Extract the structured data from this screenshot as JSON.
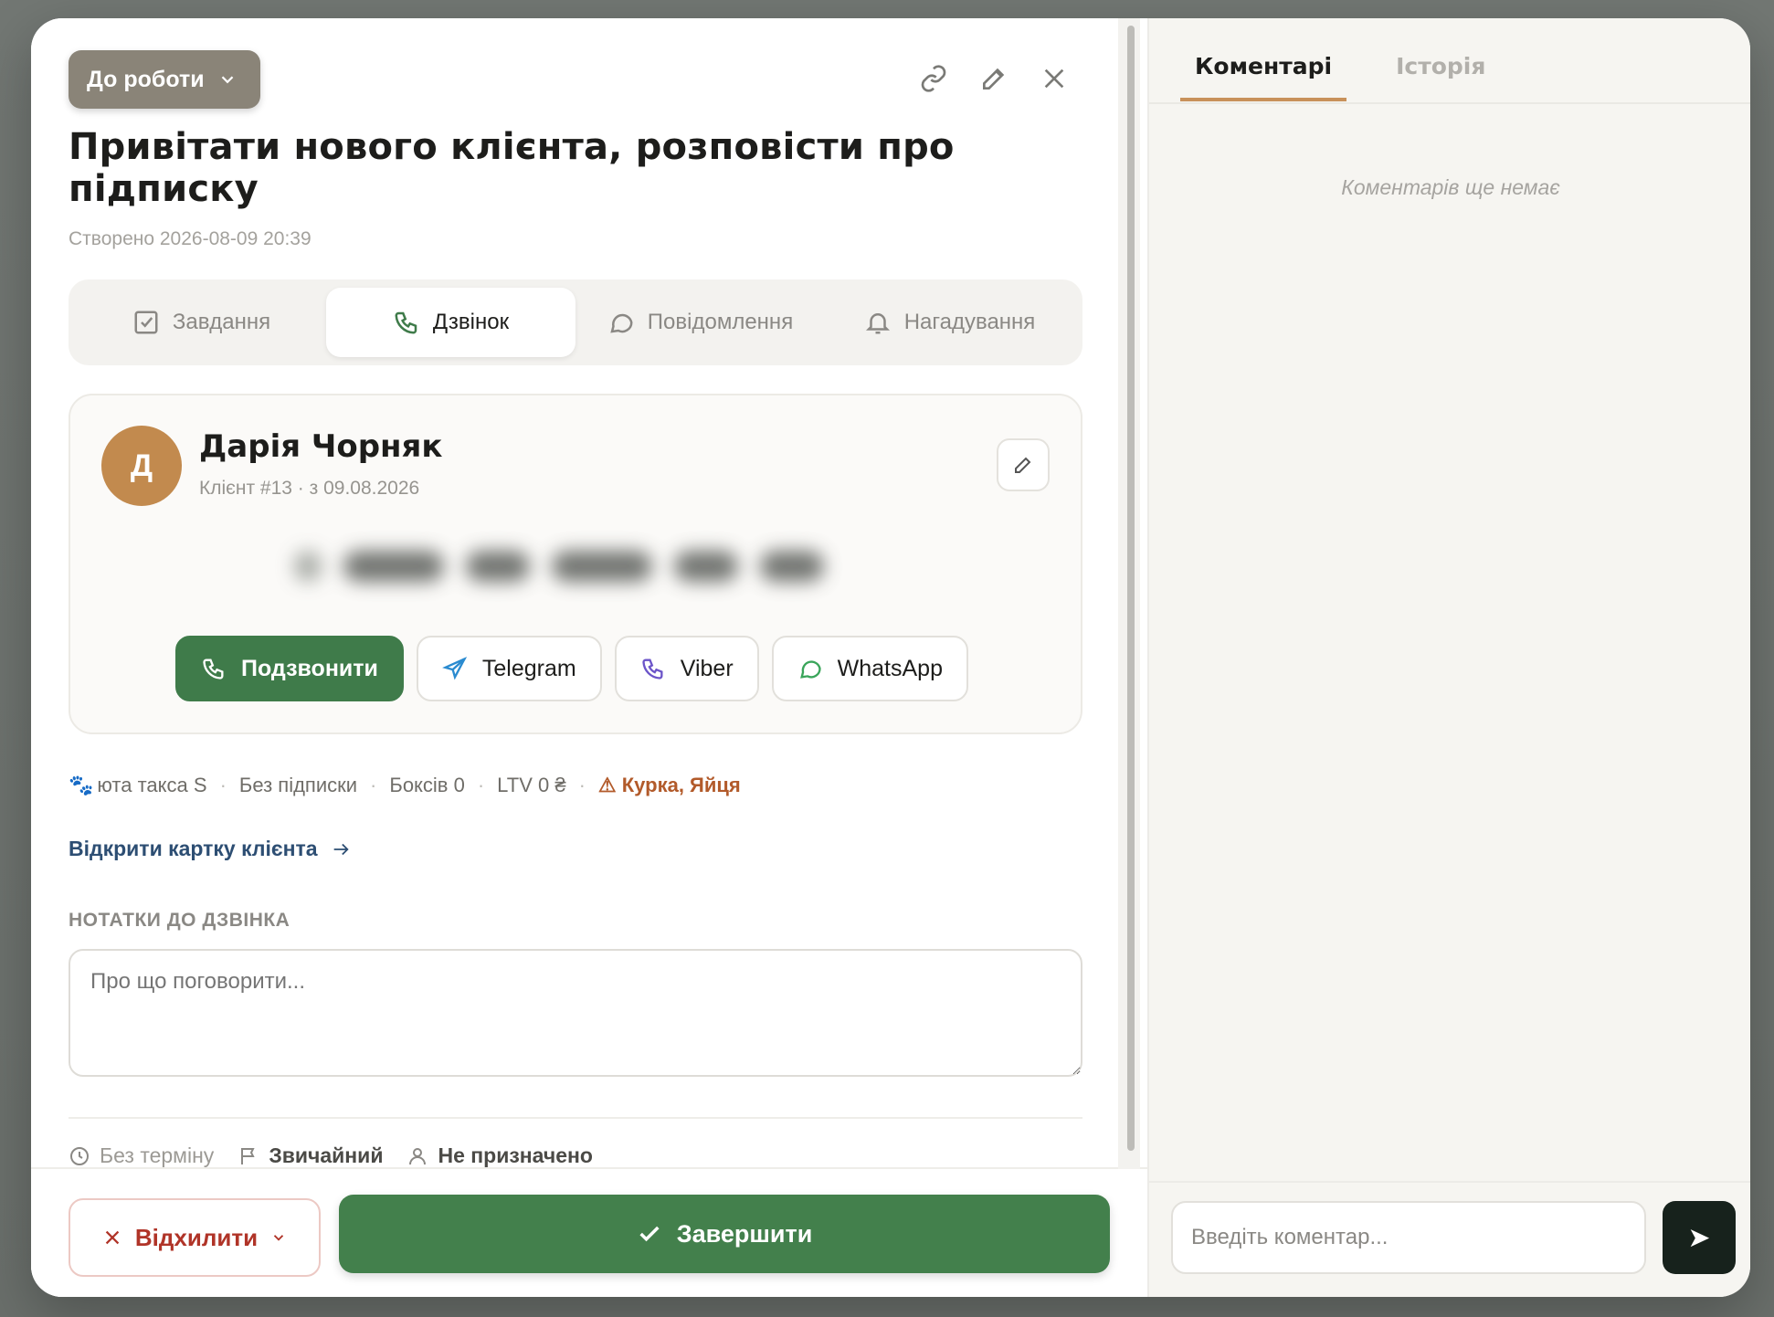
{
  "task": {
    "status_label": "До роботи",
    "title": "Привітати нового клієнта, розповісти про підписку",
    "created": "Створено 2026-08-09 20:39",
    "tabs": [
      {
        "label": "Завдання",
        "icon": "checkbox-icon"
      },
      {
        "label": "Дзвінок",
        "icon": "phone-icon"
      },
      {
        "label": "Повідомлення",
        "icon": "message-icon"
      },
      {
        "label": "Нагадування",
        "icon": "bell-icon"
      }
    ],
    "active_tab": "Дзвінок"
  },
  "client": {
    "initial": "Д",
    "name": "Дарія Чорняк",
    "subtitle": "Клієнт #13 · з 09.08.2026",
    "contacts": {
      "call": "Подзвонити",
      "telegram": "Telegram",
      "viber": "Viber",
      "whatsapp": "WhatsApp"
    },
    "meta": {
      "pet": "юта такса S",
      "subscription": "Без підписки",
      "boxes": "Боксів 0",
      "ltv": "LTV 0 ₴",
      "allergies": "⚠ Курка, Яйця"
    },
    "open_card_label": "Відкрити картку клієнта"
  },
  "notes": {
    "label": "НОТАТКИ ДО ДЗВІНКА",
    "placeholder": "Про що поговорити..."
  },
  "properties": {
    "deadline": "Без терміну",
    "priority": "Звичайний",
    "assignee": "Не призначено"
  },
  "footer": {
    "reject_label": "Відхилити",
    "complete_label": "Завершити"
  },
  "side": {
    "tabs": [
      "Коментарі",
      "Історія"
    ],
    "empty_text": "Коментарів ще немає",
    "comment_placeholder": "Введіть коментар...",
    "send_icon": "send-icon"
  },
  "colors": {
    "primary_green": "#43804c",
    "status_bg": "#8a8478",
    "avatar_bg": "#c28a4e",
    "reject_red": "#b03428",
    "link_blue": "#2d4e73",
    "tab_accent": "#c8915a"
  }
}
